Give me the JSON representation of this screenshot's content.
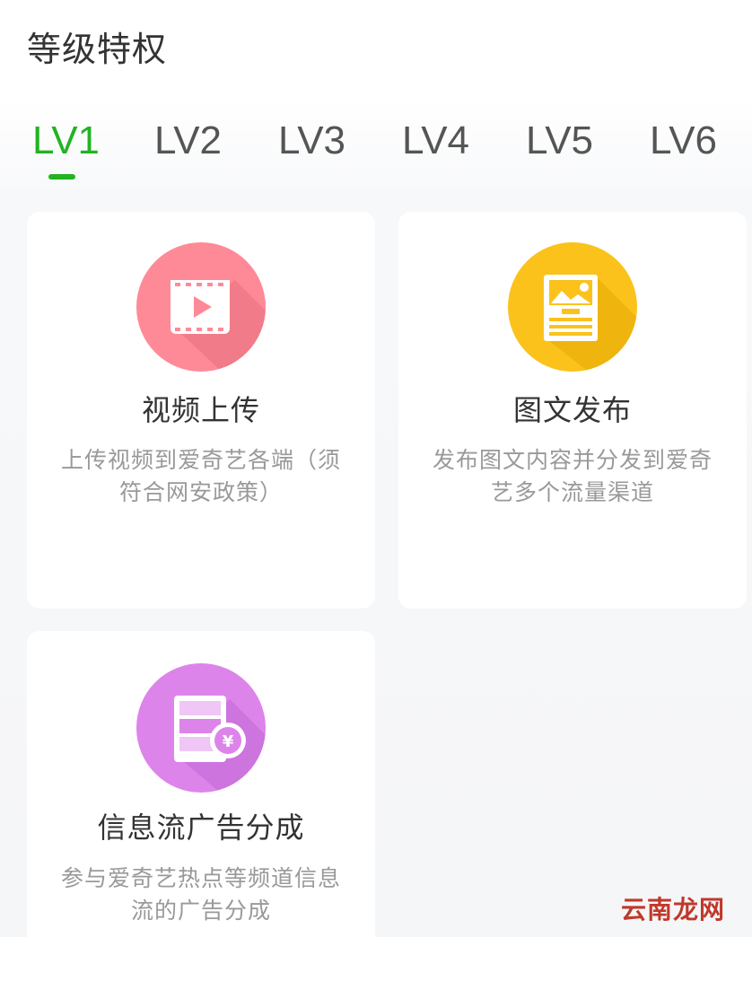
{
  "section": {
    "title": "等级特权"
  },
  "tabs": [
    {
      "label": "LV1",
      "active": true
    },
    {
      "label": "LV2",
      "active": false
    },
    {
      "label": "LV3",
      "active": false
    },
    {
      "label": "LV4",
      "active": false
    },
    {
      "label": "LV5",
      "active": false
    },
    {
      "label": "LV6",
      "active": false
    }
  ],
  "cards": [
    {
      "title": "视频上传",
      "description": "上传视频到爱奇艺各端（须符合网安政策）",
      "icon": "video-upload-icon",
      "color": "#ff8a97"
    },
    {
      "title": "图文发布",
      "description": "发布图文内容并分发到爱奇艺多个流量渠道",
      "icon": "article-publish-icon",
      "color": "#fbc21c"
    },
    {
      "title": "信息流广告分成",
      "description": "参与爱奇艺热点等频道信息流的广告分成",
      "icon": "ad-revenue-icon",
      "color": "#dd84ea"
    }
  ],
  "colors": {
    "accent": "#22b322",
    "title": "#333333",
    "description": "#999999"
  },
  "watermark": "云南龙网"
}
